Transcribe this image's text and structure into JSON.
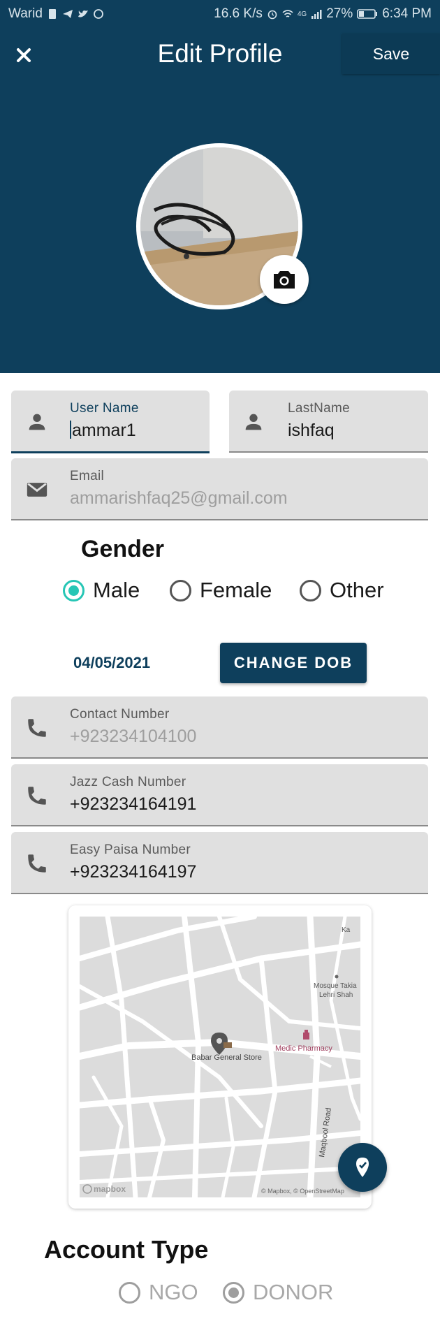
{
  "status_bar": {
    "carrier": "Warid",
    "speed": "16.6 K/s",
    "network": "4G",
    "battery": "27%",
    "time": "6:34 PM"
  },
  "header": {
    "title": "Edit Profile",
    "save_label": "Save",
    "close_icon": "close-icon"
  },
  "form": {
    "user_name": {
      "label": "User Name",
      "value": "ammar1"
    },
    "last_name": {
      "label": "LastName",
      "value": "ishfaq"
    },
    "email": {
      "label": "Email",
      "value": "ammarishfaq25@gmail.com"
    },
    "gender": {
      "title": "Gender",
      "options": [
        "Male",
        "Female",
        "Other"
      ],
      "selected": "Male"
    },
    "dob": {
      "value": "04/05/2021",
      "button_label": "CHANGE DOB"
    },
    "contact": {
      "label": "Contact Number",
      "value": "+923234104100"
    },
    "jazz_cash": {
      "label": "Jazz Cash Number",
      "value": "+923234164191"
    },
    "easy_paisa": {
      "label": "Easy Paisa Number",
      "value": "+923234164197"
    }
  },
  "map": {
    "labels": {
      "mosque": "Mosque Takia Lehri Shah",
      "mosque_line1": "Mosque Takia",
      "mosque_line2": "Lehri Shah",
      "pharmacy": "Medic Pharmacy",
      "store": "Babar General Store",
      "road": "Maqbool Road",
      "corner": "Ka",
      "logo": "mapbox",
      "attribution": "© Mapbox, © OpenStreetMap"
    }
  },
  "account_type": {
    "title": "Account Type",
    "options": [
      "NGO",
      "DONOR"
    ],
    "selected": "DONOR"
  },
  "colors": {
    "primary": "#0e3f5c",
    "accent": "#26c6b5",
    "field_bg": "#e0e0e0"
  }
}
